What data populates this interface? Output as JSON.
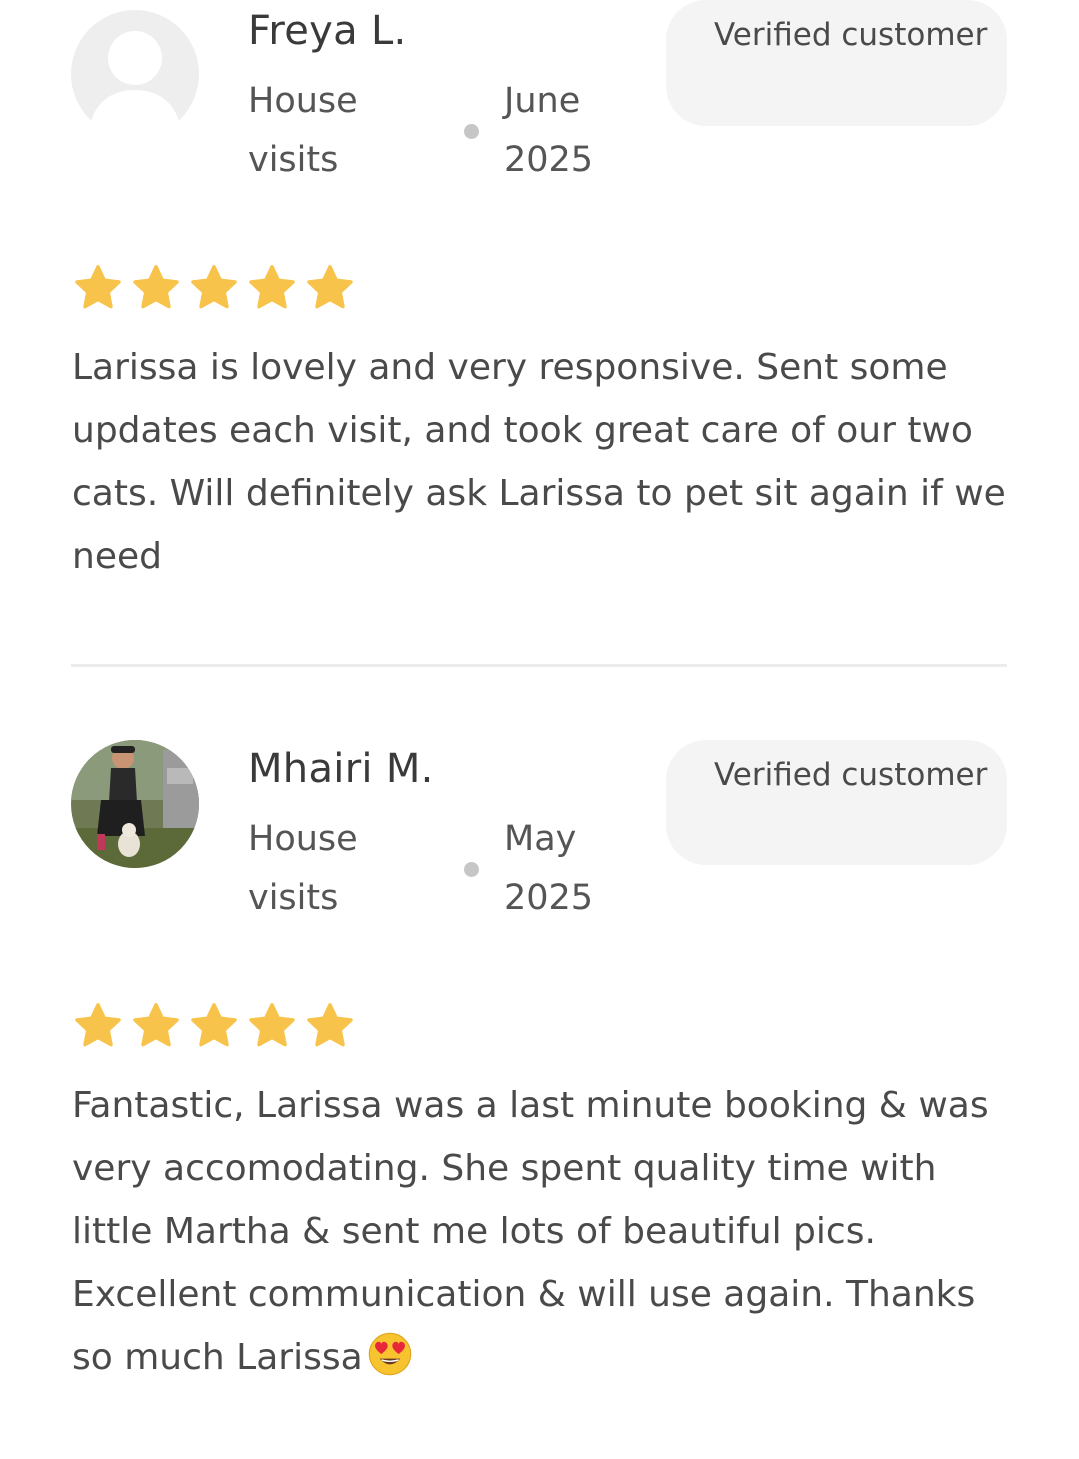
{
  "colors": {
    "star": "#f8c34a",
    "badge_bg": "#f4f4f4",
    "divider": "#ececec",
    "dot": "#c6c6c6"
  },
  "reviews": [
    {
      "name": "Freya L.",
      "service": "House visits",
      "date": "June 2025",
      "badge": "Verified customer",
      "avatar_icon": "default-user-silhouette-icon",
      "rating": 5,
      "text": "Larissa is lovely and very responsive. Sent some updates each visit, and took great care of our two cats. Will definitely ask Larissa to pet sit again if we need"
    },
    {
      "name": "Mhairi M.",
      "service": "House visits",
      "date": "May 2025",
      "badge": "Verified customer",
      "avatar_icon": "user-photo-avatar",
      "rating": 5,
      "text": "Fantastic, Larissa was a last minute booking & was very accomodating. She spent quality time with little Martha & sent me lots of beautiful pics. Excellent communication & will use again. Thanks so much Larissa",
      "emoji": "heart-eyes-emoji"
    }
  ]
}
